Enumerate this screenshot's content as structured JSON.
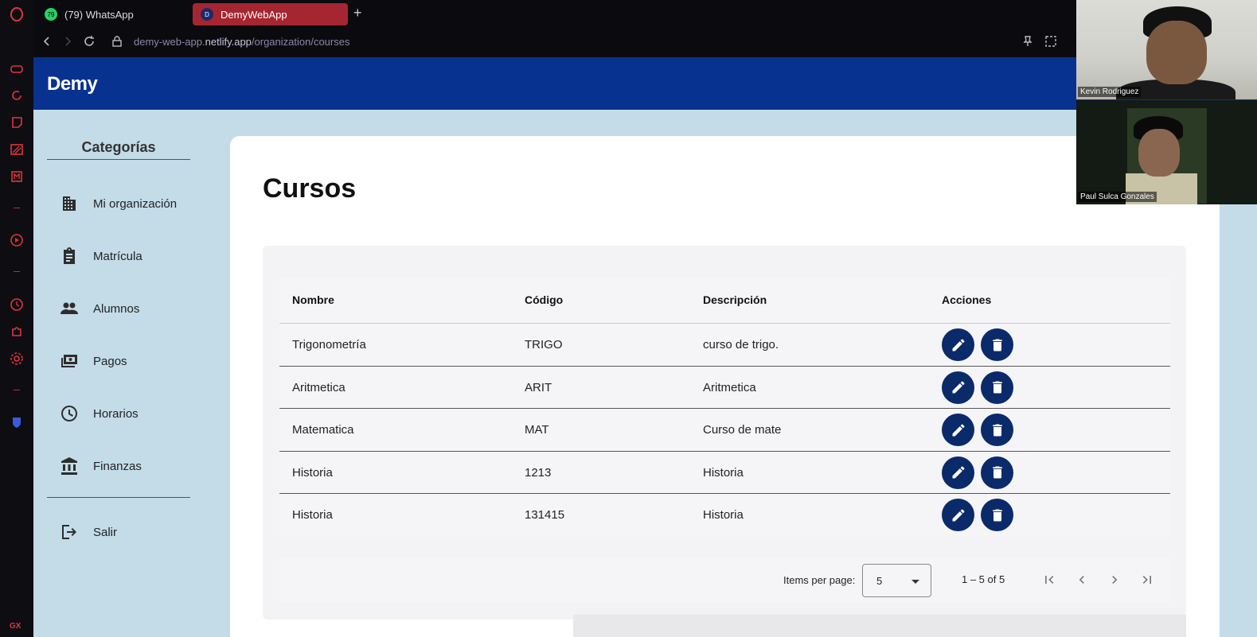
{
  "browser": {
    "tabs": [
      {
        "label": "(79) WhatsApp",
        "badge": "79"
      },
      {
        "label": "DemyWebApp"
      }
    ],
    "new_tab": "+",
    "url_prefix": "demy-web-app.",
    "url_host": "netlify.app",
    "url_path": "/organization/courses",
    "rail_footer": "GX"
  },
  "app": {
    "brand": "Demy",
    "sidebar": {
      "title": "Categorías",
      "items": [
        {
          "label": "Mi organización",
          "icon": "building-icon"
        },
        {
          "label": "Matrícula",
          "icon": "clipboard-icon"
        },
        {
          "label": "Alumnos",
          "icon": "people-icon"
        },
        {
          "label": "Pagos",
          "icon": "payments-icon"
        },
        {
          "label": "Horarios",
          "icon": "clock-icon"
        },
        {
          "label": "Finanzas",
          "icon": "bank-icon"
        }
      ],
      "logout": {
        "label": "Salir",
        "icon": "logout-icon"
      }
    },
    "page_title": "Cursos",
    "table": {
      "headers": [
        "Nombre",
        "Código",
        "Descripción",
        "Acciones"
      ],
      "rows": [
        {
          "nombre": "Trigonometría",
          "codigo": "TRIGO",
          "descripcion": "curso de trigo."
        },
        {
          "nombre": "Aritmetica",
          "codigo": "ARIT",
          "descripcion": "Aritmetica"
        },
        {
          "nombre": "Matematica",
          "codigo": "MAT",
          "descripcion": "Curso de mate"
        },
        {
          "nombre": "Historia",
          "codigo": "1213",
          "descripcion": "Historia"
        },
        {
          "nombre": "Historia",
          "codigo": "131415",
          "descripcion": "Historia"
        }
      ]
    },
    "paginator": {
      "items_per_page_label": "Items per page:",
      "page_size": "5",
      "range_label": "1 – 5 of 5"
    }
  },
  "video_call": {
    "participants": [
      "Kevin Rodriguez",
      "Paul Sulca Gonzales"
    ]
  },
  "colors": {
    "appbar": "#08328f",
    "sidebar_bg": "#c3dce8",
    "action_button": "#0a2a6a",
    "active_tab": "#a52630"
  }
}
